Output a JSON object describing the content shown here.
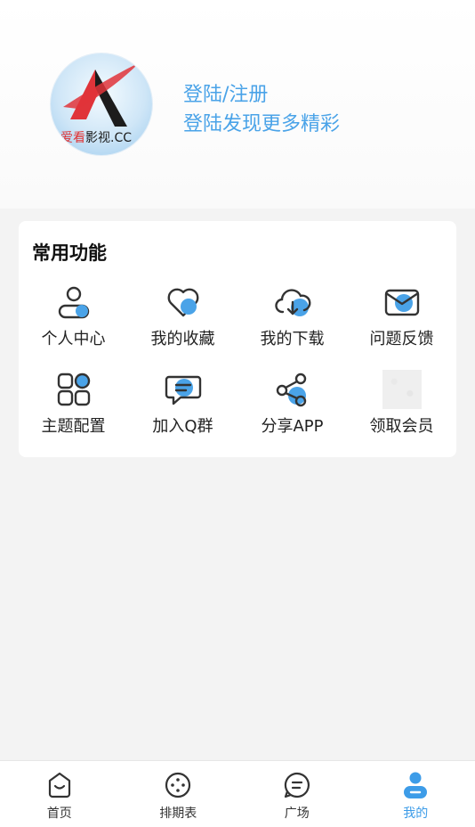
{
  "profile": {
    "avatar_text_red": "爱看",
    "avatar_text_dark": "影视.CC",
    "login_label": "登陆/注册",
    "login_subtitle": "登陆发现更多精彩"
  },
  "features": {
    "title": "常用功能",
    "items": [
      {
        "label": "个人中心",
        "icon": "user-icon"
      },
      {
        "label": "我的收藏",
        "icon": "heart-icon"
      },
      {
        "label": "我的下载",
        "icon": "cloud-download-icon"
      },
      {
        "label": "问题反馈",
        "icon": "mail-icon"
      },
      {
        "label": "主题配置",
        "icon": "grid-icon"
      },
      {
        "label": "加入Q群",
        "icon": "chat-icon"
      },
      {
        "label": "分享APP",
        "icon": "share-icon"
      },
      {
        "label": "领取会员",
        "icon": "vip-image"
      }
    ]
  },
  "nav": {
    "items": [
      {
        "label": "首页",
        "icon": "home-icon"
      },
      {
        "label": "排期表",
        "icon": "schedule-icon"
      },
      {
        "label": "广场",
        "icon": "square-icon"
      },
      {
        "label": "我的",
        "icon": "profile-icon",
        "active": true
      }
    ]
  },
  "colors": {
    "accent": "#3d9ce8",
    "accent_fill": "#4aa3e8",
    "icon_stroke": "#333333",
    "background": "#f3f3f3"
  }
}
